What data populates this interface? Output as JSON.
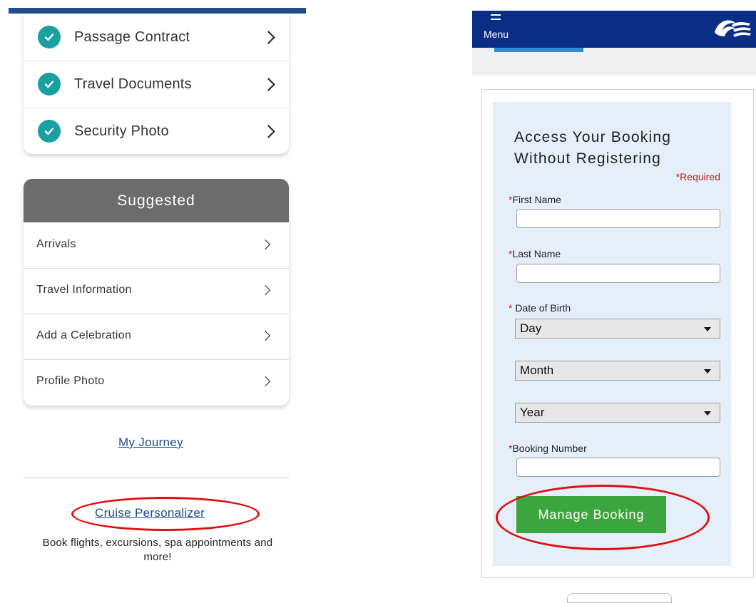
{
  "left": {
    "checklist": [
      {
        "label": "Passage Contract"
      },
      {
        "label": "Travel Documents"
      },
      {
        "label": "Security Photo"
      }
    ],
    "suggested": {
      "heading": "Suggested",
      "items": [
        {
          "label": "Arrivals"
        },
        {
          "label": "Travel Information"
        },
        {
          "label": "Add a Celebration"
        },
        {
          "label": "Profile Photo"
        }
      ]
    },
    "my_journey_link": "My Journey",
    "cruise_personalizer_link": "Cruise Personalizer",
    "cruise_personalizer_desc": "Book flights, excursions, spa appointments and more!"
  },
  "right": {
    "nav": {
      "menu_label": "Menu"
    },
    "form": {
      "title_line1": "Access Your Booking",
      "title_line2": "Without Registering",
      "required_note": "Required",
      "required_star": "*",
      "first_name_label": "First Name",
      "last_name_label": "Last Name",
      "dob_label": "Date of Birth",
      "day_select": "Day",
      "month_select": "Month",
      "year_select": "Year",
      "booking_number_label": "Booking Number",
      "submit_label": "Manage Booking"
    }
  },
  "colors": {
    "nav_blue": "#0a2d86",
    "check_teal": "#1aa0a0",
    "button_green": "#3ca63e",
    "highlight_red": "#e01010",
    "link_blue": "#1d4f86",
    "required_red": "#c31b1b"
  },
  "icons": [
    "check-circle-icon",
    "chevron-right-icon",
    "hamburger-menu-icon",
    "wave-logo-icon",
    "caret-down-icon"
  ]
}
